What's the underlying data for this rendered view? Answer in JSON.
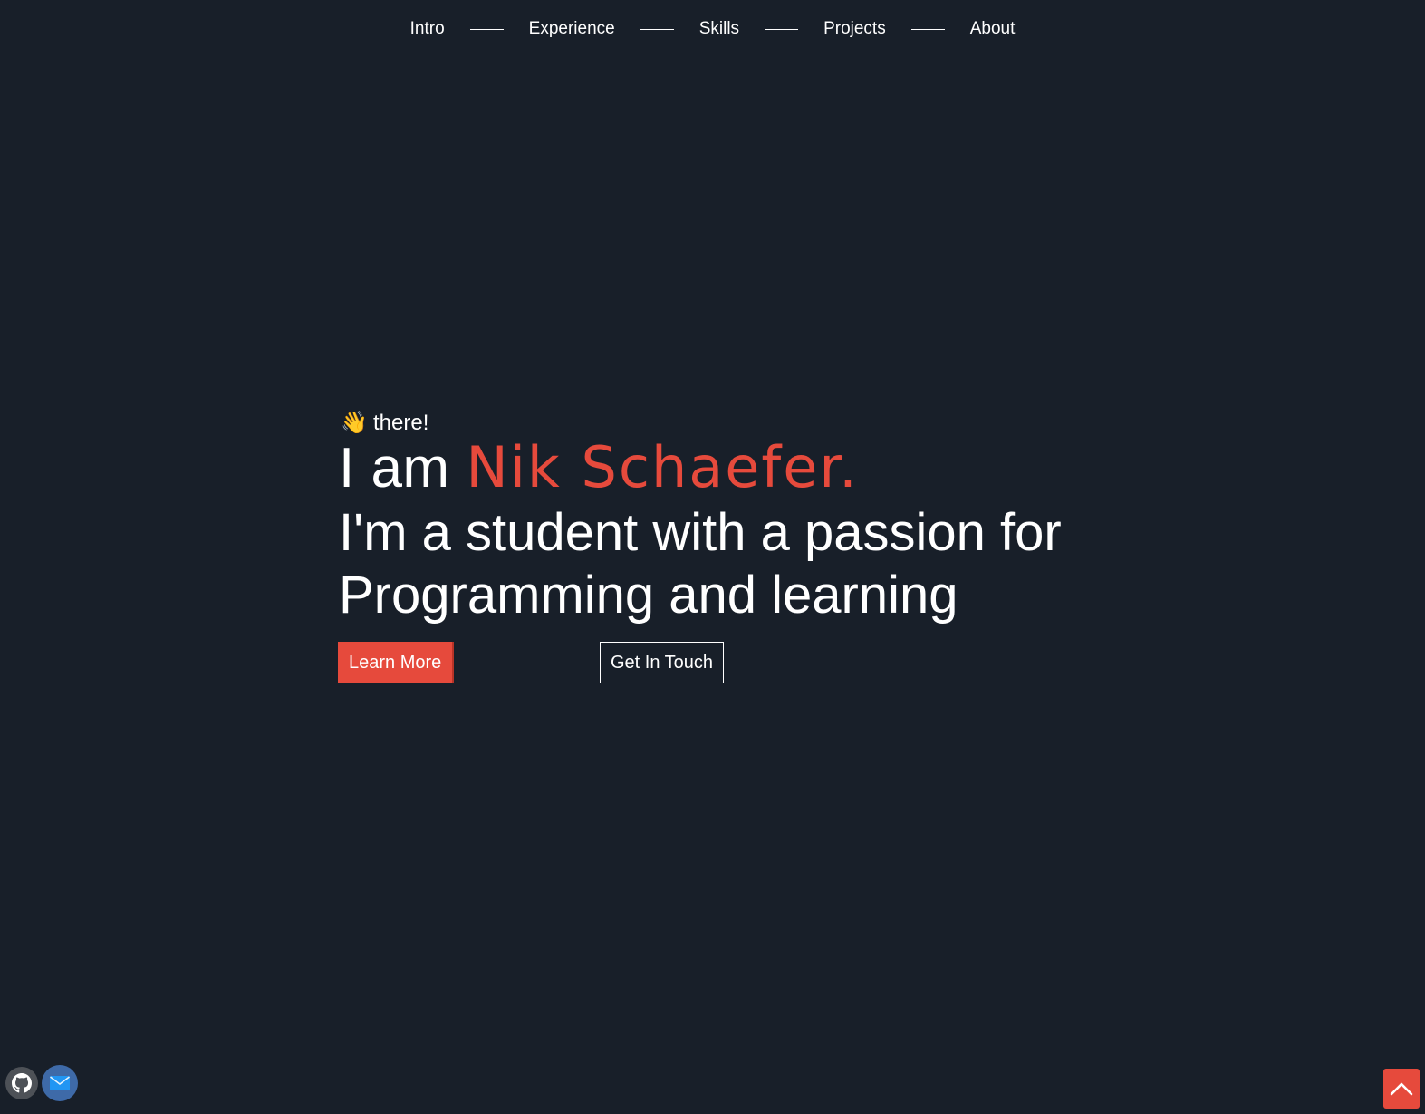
{
  "nav": {
    "items": [
      {
        "label": "Intro"
      },
      {
        "label": "Experience"
      },
      {
        "label": "Skills"
      },
      {
        "label": "Projects"
      },
      {
        "label": "About"
      }
    ]
  },
  "hero": {
    "greeting_icon": "waving-hand-icon",
    "greeting_icon_glyph": "👋",
    "greeting": "there!",
    "headline_prefix": "I am ",
    "name": "Nik Schaefer.",
    "tagline": "I'm a student with a passion for Programming and learning",
    "primary_button": "Learn More",
    "secondary_button": "Get In Touch"
  },
  "social": {
    "icons": [
      "github-icon",
      "mail-icon"
    ]
  },
  "scroll_top": {
    "icon": "chevron-up-icon"
  },
  "colors": {
    "background": "#181f29",
    "accent": "#e64a3c",
    "text": "#ffffff"
  }
}
